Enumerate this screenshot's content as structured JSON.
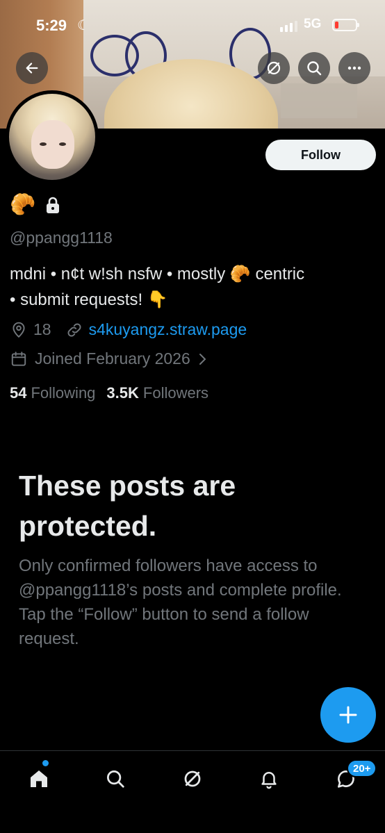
{
  "status_bar": {
    "time": "5:29",
    "network": "5G"
  },
  "header": {
    "back_icon": "arrow-left-icon",
    "actions": [
      "grok-icon",
      "search-icon",
      "more-icon"
    ]
  },
  "profile": {
    "follow_label": "Follow",
    "display_name_emoji": "🥐",
    "lock_icon": "lock-icon",
    "handle": "@ppangg1118",
    "bio_line1": "mdni • n¢t w!sh nsfw • mostly 🥐 centric",
    "bio_line2": "• submit requests! 👇",
    "location": "18",
    "website": "s4kuyangz.straw.page",
    "joined": "Joined February 2026",
    "following_count": "54",
    "following_label": "Following",
    "followers_count": "3.5K",
    "followers_label": "Followers"
  },
  "protected": {
    "title": "These posts are protected.",
    "body": "Only confirmed followers have access to @ppangg1118’s posts and complete profile. Tap the “Follow” button to send a follow request."
  },
  "fab": {
    "icon": "plus-icon"
  },
  "tabbar": {
    "tabs": [
      "home-icon",
      "search-icon",
      "grok-icon",
      "bell-icon",
      "messages-icon"
    ],
    "messages_badge": "20+"
  },
  "colors": {
    "accent": "#1d9bf0",
    "background": "#000000",
    "muted": "#71767b"
  }
}
